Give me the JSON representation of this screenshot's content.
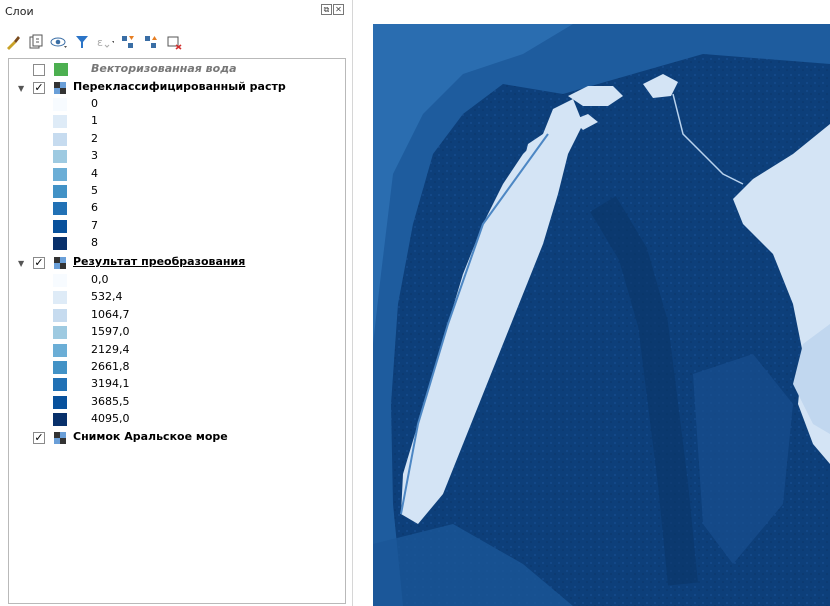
{
  "panel": {
    "title": "Слои",
    "title_buttons": [
      "⧉",
      "✕"
    ]
  },
  "toolbar": {
    "icons": [
      "paintbrush-icon",
      "add-group-icon",
      "eye-icon",
      "filter-icon",
      "expression-filter-icon",
      "expand-all-icon",
      "collapse-all-icon",
      "remove-layer-icon"
    ]
  },
  "layers": [
    {
      "name": "Векторизованная вода",
      "checked": false,
      "style": "italic",
      "swatch_color": "#4caf50"
    },
    {
      "name": "Переклассифицированный растр",
      "checked": true,
      "expanded": true,
      "style": "bold",
      "legend": [
        {
          "label": "0",
          "color": "#f7fbff"
        },
        {
          "label": "1",
          "color": "#deebf7"
        },
        {
          "label": "2",
          "color": "#c6dbef"
        },
        {
          "label": "3",
          "color": "#9ecae1"
        },
        {
          "label": "4",
          "color": "#6baed6"
        },
        {
          "label": "5",
          "color": "#4292c6"
        },
        {
          "label": "6",
          "color": "#2171b5"
        },
        {
          "label": "7",
          "color": "#08519c"
        },
        {
          "label": "8",
          "color": "#08306b"
        }
      ]
    },
    {
      "name": "Результат преобразования",
      "checked": true,
      "expanded": true,
      "style": "underline",
      "legend": [
        {
          "label": "0,0",
          "color": "#f7fbff"
        },
        {
          "label": "532,4",
          "color": "#deebf7"
        },
        {
          "label": "1064,7",
          "color": "#c6dbef"
        },
        {
          "label": "1597,0",
          "color": "#9ecae1"
        },
        {
          "label": "2129,4",
          "color": "#6baed6"
        },
        {
          "label": "2661,8",
          "color": "#4292c6"
        },
        {
          "label": "3194,1",
          "color": "#2171b5"
        },
        {
          "label": "3685,5",
          "color": "#08519c"
        },
        {
          "label": "4095,0",
          "color": "#08306b"
        }
      ]
    },
    {
      "name": "Снимок Аральское море",
      "checked": true,
      "style": "bold"
    }
  ],
  "colors": {
    "water_light": "#d4e4f5",
    "water_dark": "#0d3f7a",
    "water_mid": "#1e5c9e"
  }
}
